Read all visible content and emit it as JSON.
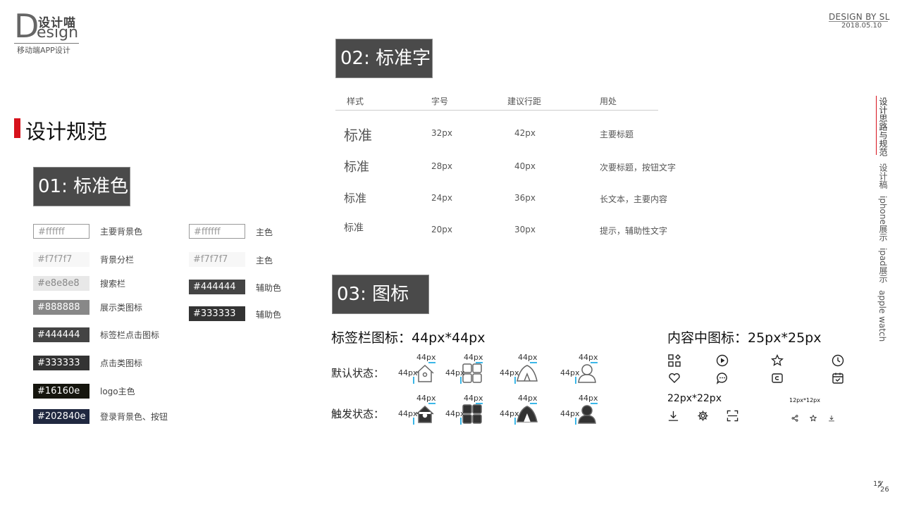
{
  "brand": {
    "logo_letter": "D",
    "logo_cn": "设计喵",
    "logo_en": "esign",
    "subtitle": "移动端APP设计"
  },
  "header": {
    "design_by": "DESIGN BY SL",
    "date": "2018.05.10"
  },
  "section": {
    "title": "设计规范"
  },
  "colors_block": {
    "title": "01: 标准色",
    "left": [
      {
        "hex": "#ffffff",
        "label": "主要背景色",
        "bg": "#ffffff",
        "fg": "#999999",
        "border": "#999999"
      },
      {
        "hex": "#f7f7f7",
        "label": "背景分栏",
        "bg": "#f7f7f7",
        "fg": "#999999",
        "border": ""
      },
      {
        "hex": "#e8e8e8",
        "label": "搜索栏",
        "bg": "#e8e8e8",
        "fg": "#888888",
        "border": ""
      },
      {
        "hex": "#888888",
        "label": "展示类图标",
        "bg": "#888888",
        "fg": "#ffffff",
        "border": ""
      },
      {
        "hex": "#444444",
        "label": "标签栏点击图标",
        "bg": "#444444",
        "fg": "#ffffff",
        "border": ""
      },
      {
        "hex": "#333333",
        "label": "点击类图标",
        "bg": "#333333",
        "fg": "#ffffff",
        "border": ""
      },
      {
        "hex": "#16160e",
        "label": "logo主色",
        "bg": "#16160e",
        "fg": "#ffffff",
        "border": ""
      },
      {
        "hex": "#202840e",
        "label": "登录背景色、按钮",
        "bg": "#202840",
        "fg": "#ffffff",
        "border": ""
      }
    ],
    "right": [
      {
        "hex": "#ffffff",
        "label": "主色",
        "bg": "#ffffff",
        "fg": "#999999",
        "border": "#999999"
      },
      {
        "hex": "#f7f7f7",
        "label": "主色",
        "bg": "#f7f7f7",
        "fg": "#999999",
        "border": ""
      },
      {
        "hex": "#444444",
        "label": "辅助色",
        "bg": "#444444",
        "fg": "#ffffff",
        "border": ""
      },
      {
        "hex": "#333333",
        "label": "辅助色",
        "bg": "#333333",
        "fg": "#ffffff",
        "border": ""
      }
    ]
  },
  "font_block": {
    "title": "02: 标准字",
    "headers": [
      "样式",
      "字号",
      "建议行距",
      "用处"
    ],
    "rows": [
      {
        "sample": "标准",
        "size": "32px",
        "line": "42px",
        "use": "主要标题"
      },
      {
        "sample": "标准",
        "size": "28px",
        "line": "40px",
        "use": "次要标题，按钮文字"
      },
      {
        "sample": "标准",
        "size": "24px",
        "line": "36px",
        "use": "长文本，主要内容"
      },
      {
        "sample": "标准",
        "size": "20px",
        "line": "30px",
        "use": "提示，辅助性文字"
      }
    ]
  },
  "icon_block": {
    "title": "03: 图标",
    "tab_title": "标签栏图标：44px*44px",
    "default_label": "默认状态：",
    "active_label": "触发状态：",
    "dim": "44px",
    "tab_icons": [
      "home-icon",
      "grid-icon",
      "tent-icon",
      "user-icon"
    ],
    "content_title": "内容中图标：25px*25px",
    "content_icons": [
      "apps-icon",
      "play-icon",
      "star-icon",
      "clock-icon",
      "heart-icon",
      "chat-icon",
      "wallet-icon",
      "calendar-icon"
    ],
    "small_title": "22px*22px",
    "small_icons": [
      "download-icon",
      "gear-icon",
      "scan-icon"
    ],
    "tiny_title": "12px*12px",
    "tiny_icons": [
      "share-icon",
      "star-icon",
      "download-icon"
    ]
  },
  "nav": {
    "items": [
      "设计思路与规范",
      "设计稿",
      "iphone展示",
      "ipad展示",
      "apple watch"
    ]
  },
  "pager": {
    "current": "15",
    "total": "26"
  }
}
